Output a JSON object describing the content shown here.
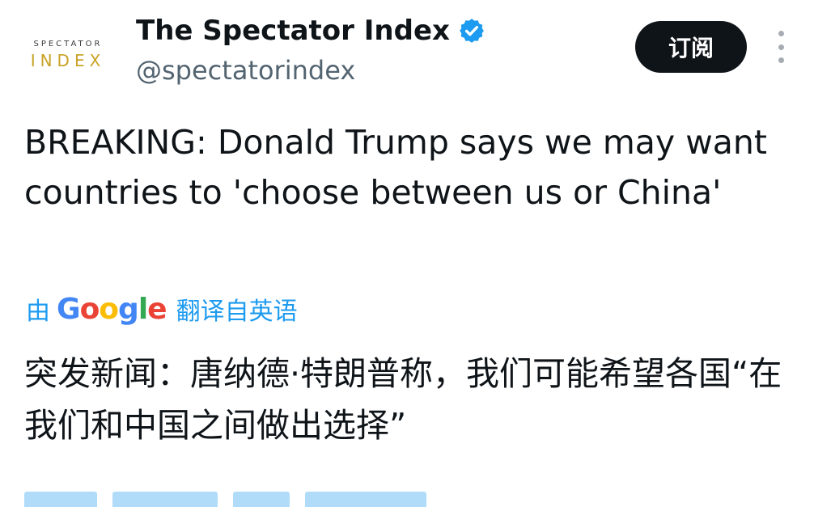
{
  "account": {
    "logo_top": "SPECTATOR",
    "logo_bottom": "INDEX",
    "display_name": "The Spectator Index",
    "handle": "@spectatorindex",
    "verified_icon": "verified-badge-icon",
    "verified_color": "#1d9bf0"
  },
  "actions": {
    "subscribe_label": "订阅",
    "more_icon": "more-vertical-icon"
  },
  "tweet": {
    "text": "BREAKING: Donald Trump says we may want countries to 'choose between us or China'"
  },
  "translation": {
    "prefix": "由",
    "provider": "Google",
    "suffix": "翻译自英语",
    "link_color": "#1d9bf0",
    "text": "突发新闻：唐纳德·特朗普称，我们可能希望各国“在我们和中国之间做出选择”"
  },
  "colors": {
    "text_primary": "#0f1419",
    "text_secondary": "#536471",
    "button_bg": "#0f1419",
    "logo_gold": "#c9a227"
  }
}
